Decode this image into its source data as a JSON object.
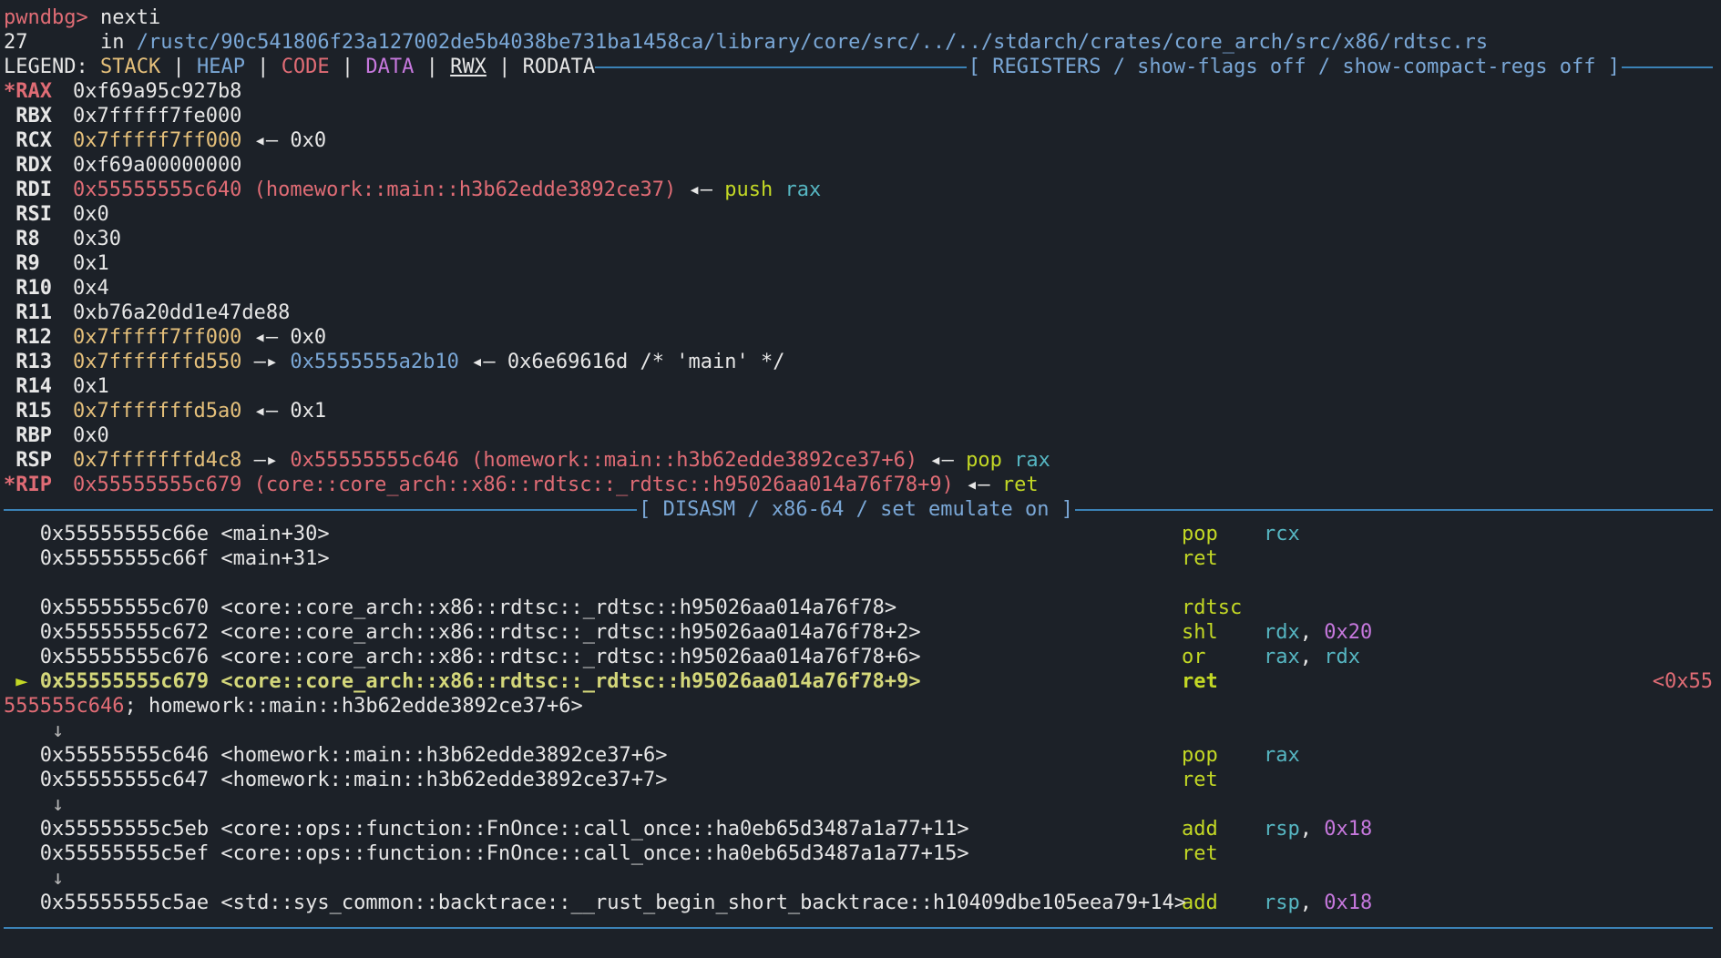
{
  "prompt": {
    "label": "pwndbg>",
    "command": " nexti"
  },
  "line_info": {
    "lineno": "27",
    "sep": "      in ",
    "path": "/rustc/90c541806f23a127002de5b4038be731ba1458ca/library/core/src/../../stdarch/crates/core_arch/src/x86/rdtsc.rs"
  },
  "legend": {
    "label": "LEGEND: ",
    "stack": "STACK",
    "heap": "HEAP",
    "code": "CODE",
    "data": "DATA",
    "rwx": "RWX",
    "rodata": "RODATA",
    "pipe": " | "
  },
  "registers_header": "[ REGISTERS / show-flags off / show-compact-regs off ]",
  "registers": {
    "rax": {
      "name": "*RAX",
      "val": "0xf69a95c927b8"
    },
    "rbx": {
      "name": " RBX",
      "val": "0x7fffff7fe000"
    },
    "rcx": {
      "name": " RCX",
      "val": "0x7fffff7ff000",
      "arrow": " ◂— ",
      "deref": "0x0"
    },
    "rdi": {
      "name": " RDI",
      "val": "0x55555555c640 (homework::main::h3b62edde3892ce37)",
      "arrow": " ◂— ",
      "ins": "push",
      "op": "rax"
    },
    "rdx": {
      "name": " RDX",
      "val": "0xf69a00000000"
    },
    "rsi": {
      "name": " RSI",
      "val": "0x0"
    },
    "r8": {
      "name": " R8",
      "val": "0x30"
    },
    "r9": {
      "name": " R9",
      "val": "0x1"
    },
    "r10": {
      "name": " R10",
      "val": "0x4"
    },
    "r11": {
      "name": " R11",
      "val": "0xb76a20dd1e47de88"
    },
    "r12": {
      "name": " R12",
      "val": "0x7fffff7ff000",
      "arrow": " ◂— ",
      "deref": "0x0"
    },
    "r13": {
      "name": " R13",
      "val": "0x7fffffffd550",
      "arrow1": " —▸ ",
      "ptr": "0x5555555a2b10",
      "arrow2": " ◂— ",
      "deref": "0x6e69616d /* 'main' */"
    },
    "r14": {
      "name": " R14",
      "val": "0x1"
    },
    "r15": {
      "name": " R15",
      "val": "0x7fffffffd5a0",
      "arrow": " ◂— ",
      "deref": "0x1"
    },
    "rbp": {
      "name": " RBP",
      "val": "0x0"
    },
    "rsp": {
      "name": " RSP",
      "val": "0x7fffffffd4c8",
      "arrow1": " —▸ ",
      "ptr": "0x55555555c646 (homework::main::h3b62edde3892ce37+6)",
      "arrow2": " ◂— ",
      "ins": "pop",
      "op": "rax"
    },
    "rip": {
      "name": "*RIP",
      "val": "0x55555555c679 (core::core_arch::x86::rdtsc::_rdtsc::h95026aa014a76f78+9)",
      "arrow": " ◂— ",
      "ins": "ret"
    }
  },
  "disasm_header": "[ DISASM / x86-64 / set emulate on ]",
  "disasm": {
    "l1": {
      "addr": "   0x55555555c66e <main+30>",
      "mn": "pop",
      "op1": "rcx"
    },
    "l2": {
      "addr": "   0x55555555c66f <main+31>",
      "mn": "ret"
    },
    "l3": {
      "addr": "   0x55555555c670 <core::core_arch::x86::rdtsc::_rdtsc::h95026aa014a76f78>",
      "mn": "rdtsc"
    },
    "l4": {
      "addr": "   0x55555555c672 <core::core_arch::x86::rdtsc::_rdtsc::h95026aa014a76f78+2>",
      "mn": "shl",
      "op1": "rdx",
      "comma": ", ",
      "op2": "0x20"
    },
    "l5": {
      "addr": "   0x55555555c676 <core::core_arch::x86::rdtsc::_rdtsc::h95026aa014a76f78+6>",
      "mn": "or",
      "op1": "rax",
      "comma": ", ",
      "op2": "rdx"
    },
    "l6": {
      "marker": " ► ",
      "addr": "0x55555555c679 <core::core_arch::x86::rdtsc::_rdtsc::h95026aa014a76f78+9>",
      "mn": "ret",
      "target_a": "<0x55",
      "target_b": "555555c646",
      "target_c": "; homework::main::h3b62edde3892ce37+6>"
    },
    "arrow": "    ↓",
    "l7": {
      "addr": "   0x55555555c646 <homework::main::h3b62edde3892ce37+6>",
      "mn": "pop",
      "op1": "rax"
    },
    "l8": {
      "addr": "   0x55555555c647 <homework::main::h3b62edde3892ce37+7>",
      "mn": "ret"
    },
    "l9": {
      "addr": "   0x55555555c5eb <core::ops::function::FnOnce::call_once::ha0eb65d3487a1a77+11>",
      "mn": "add",
      "op1": "rsp",
      "comma": ", ",
      "op2": "0x18"
    },
    "l10": {
      "addr": "   0x55555555c5ef <core::ops::function::FnOnce::call_once::ha0eb65d3487a1a77+15>",
      "mn": "ret"
    },
    "l11": {
      "addr": "   0x55555555c5ae <std::sys_common::backtrace::__rust_begin_short_backtrace::h10409dbe105eea79+14>",
      "mn": "add",
      "op1": "rsp",
      "comma": ", ",
      "op2": "0x18"
    }
  },
  "colors": {
    "background": "#1c2128",
    "prompt": "#e06c75",
    "code": "#e06c75",
    "stack": "#e5c07b",
    "heap": "#7aa7d6",
    "data": "#c678dd",
    "mnemonic": "#c3d825",
    "register_operand": "#56b6c2",
    "immediate": "#c678dd",
    "separator": "#3b82b6"
  }
}
